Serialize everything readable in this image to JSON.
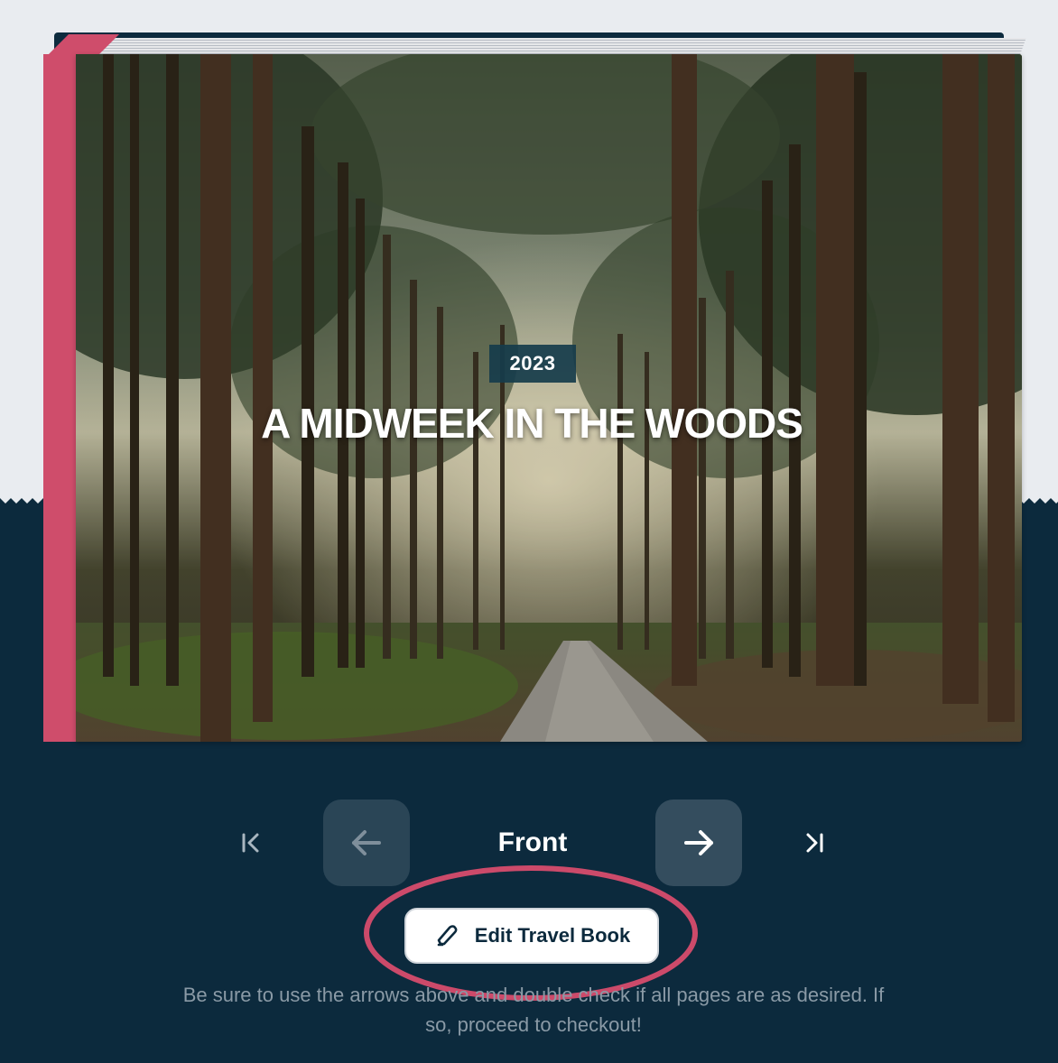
{
  "book": {
    "year": "2023",
    "title": "A MIDWEEK IN THE WOODS",
    "spine_color": "#cf4d6b",
    "cover_image": "forest-path-photo"
  },
  "navigation": {
    "first_icon": "skip-to-first-icon",
    "prev_icon": "arrow-left-icon",
    "current_page": "Front",
    "next_icon": "arrow-right-icon",
    "last_icon": "skip-to-last-icon"
  },
  "actions": {
    "edit_label": "Edit Travel Book",
    "edit_icon": "pencil-icon",
    "highlight_color": "#cc4a6a"
  },
  "help_text": "Be sure to use the arrows above and double check if all pages are as desired. If so, proceed to checkout!",
  "colors": {
    "top_background": "#e9ecf0",
    "bottom_background": "#0c2a3d",
    "button_dark": "#2a4556"
  }
}
